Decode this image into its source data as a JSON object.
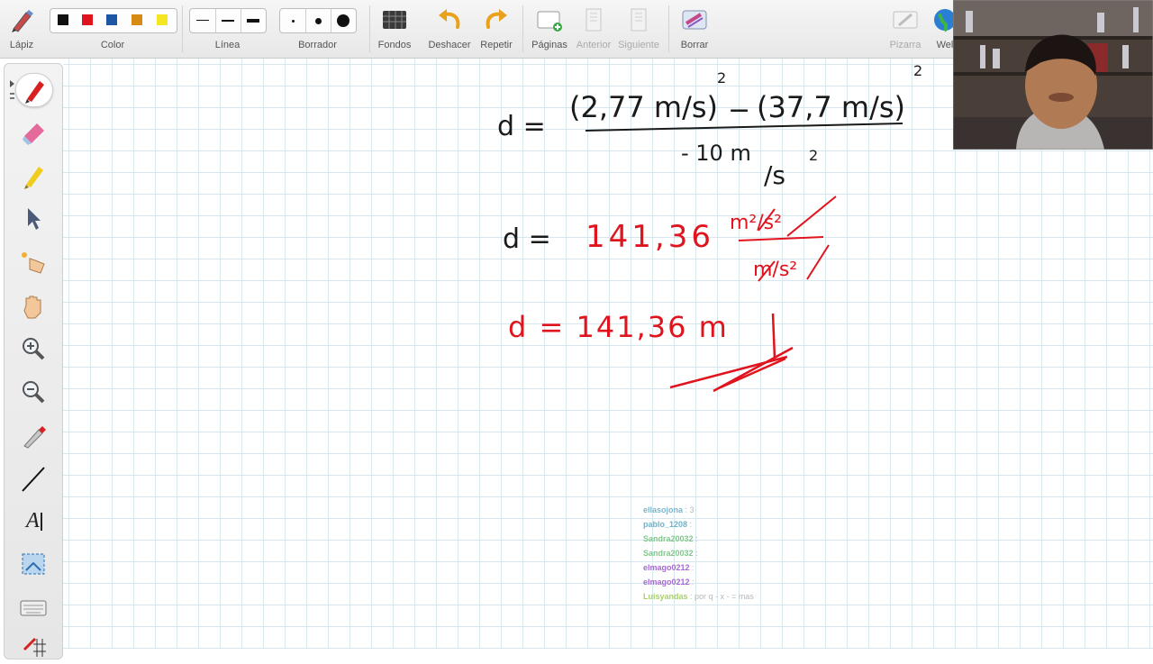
{
  "toolbar": {
    "lapiz": "Lápiz",
    "color": "Color",
    "linea": "Línea",
    "borrador": "Borrador",
    "fondos": "Fondos",
    "deshacer": "Deshacer",
    "repetir": "Repetir",
    "paginas": "Páginas",
    "anterior": "Anterior",
    "siguiente": "Siguiente",
    "borrar": "Borrar",
    "pizarra": "Pizarra",
    "web": "Wel",
    "swatches": [
      "#111111",
      "#e0141e",
      "#1f55a5",
      "#d78a14",
      "#f4e623"
    ]
  },
  "left_tools": [
    "pen-icon",
    "eraser-icon",
    "highlighter-icon",
    "select-arrow-icon",
    "laser-pointer-icon",
    "hand-icon",
    "zoom-in-icon",
    "zoom-out-icon",
    "color-picker-icon",
    "line-icon",
    "text-icon",
    "screen-capture-icon",
    "keyboard-icon",
    "grid-icon"
  ],
  "text_tool_label": "A",
  "ink": {
    "line1": {
      "lhs": "d =",
      "numerator_left": "(2,77  m/s)",
      "exp_left": "2",
      "minus": "−",
      "numerator_right": "(37,7 m/s)",
      "exp_right": "2",
      "denominator": "- 10  m",
      "denominator_unit": "/s",
      "denominator_exp": "2"
    },
    "line2": {
      "lhs": "d =",
      "value": "141,36",
      "unit_num": "m²/s²",
      "unit_den": "m/s²"
    },
    "line3": {
      "text": "d = 141,36 m"
    },
    "colors": {
      "black": "#1a1a1a",
      "red": "#e0141e"
    }
  },
  "chat": [
    {
      "user": "ellasojona",
      "msg": ": 3"
    },
    {
      "user": "pablo_1208",
      "msg": ":"
    },
    {
      "user": "Sandra20032",
      "msg": ":"
    },
    {
      "user": "Sandra20032",
      "msg": ":"
    },
    {
      "user": "elmago0212",
      "msg": ":"
    },
    {
      "user": "elmago0212",
      "msg": ":"
    },
    {
      "user": "Luisyandas",
      "msg": ": por q - x - = mas"
    }
  ]
}
